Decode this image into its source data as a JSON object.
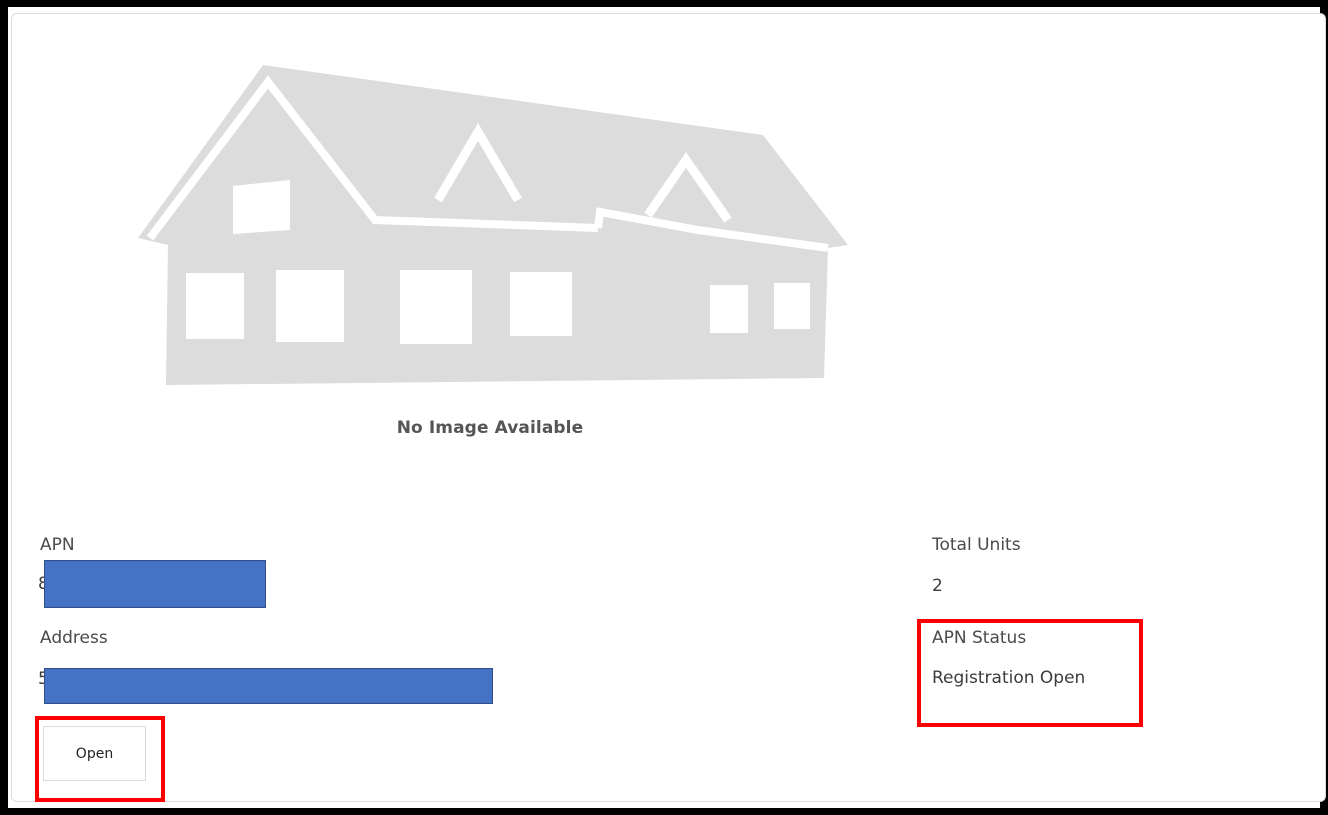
{
  "placeholder": {
    "caption": "No Image Available"
  },
  "fields": {
    "apn_label": "APN",
    "apn_value_visible": "8",
    "address_label": "Address",
    "address_value_visible": "5",
    "total_units_label": "Total Units",
    "total_units_value": "2",
    "apn_status_label": "APN Status",
    "apn_status_value": "Registration Open"
  },
  "actions": {
    "open_label": "Open"
  },
  "colors": {
    "redaction": "#4472c4",
    "highlight": "#ff0000",
    "placeholder_gray": "#dcdcdc"
  },
  "icons": {
    "placeholder_image": "house-placeholder-icon"
  }
}
